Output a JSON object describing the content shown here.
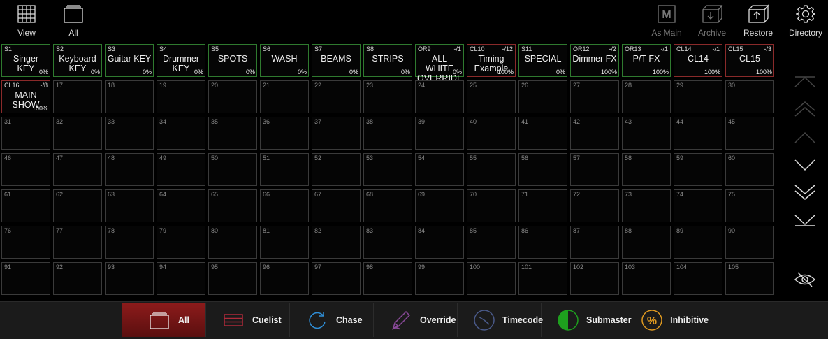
{
  "toolbar": {
    "view_label": "View",
    "all_label": "All",
    "as_main_label": "As Main",
    "archive_label": "Archive",
    "restore_label": "Restore",
    "directory_label": "Directory"
  },
  "cells": [
    {
      "num": "S1",
      "name": "Singer KEY",
      "pct": "0%",
      "color": "green"
    },
    {
      "num": "S2",
      "name": "Keyboard KEY",
      "pct": "0%",
      "color": "green"
    },
    {
      "num": "S3",
      "name": "Guitar KEY",
      "pct": "0%",
      "color": "green"
    },
    {
      "num": "S4",
      "name": "Drummer KEY",
      "pct": "0%",
      "color": "green"
    },
    {
      "num": "S5",
      "name": "SPOTS",
      "pct": "0%",
      "color": "green"
    },
    {
      "num": "S6",
      "name": "WASH",
      "pct": "0%",
      "color": "green"
    },
    {
      "num": "S7",
      "name": "BEAMS",
      "pct": "0%",
      "color": "green"
    },
    {
      "num": "S8",
      "name": "STRIPS",
      "pct": "0%",
      "color": "green"
    },
    {
      "num": "OR9",
      "steps": "-/1",
      "name": "ALL WHITE OVERRIDE",
      "pct": "0%",
      "color": "green"
    },
    {
      "num": "CL10",
      "steps": "-/12",
      "name": "Timing Example",
      "pct": "100%",
      "color": "red"
    },
    {
      "num": "S11",
      "name": "SPECIAL",
      "pct": "0%",
      "color": "green"
    },
    {
      "num": "OR12",
      "steps": "-/2",
      "name": "Dimmer FX",
      "pct": "100%",
      "color": "green"
    },
    {
      "num": "OR13",
      "steps": "-/1",
      "name": "P/T FX",
      "pct": "100%",
      "color": "green"
    },
    {
      "num": "CL14",
      "steps": "-/1",
      "name": "CL14",
      "pct": "100%",
      "color": "red"
    },
    {
      "num": "CL15",
      "steps": "-/3",
      "name": "CL15",
      "pct": "100%",
      "color": "red"
    },
    {
      "num": "CL16",
      "steps": "-/8",
      "name": "MAIN SHOW",
      "pct": "100%",
      "color": "red"
    }
  ],
  "empty_start": 17,
  "empty_end": 105,
  "bottom_tabs": [
    {
      "label": "All",
      "icon": "pages-icon",
      "active": true
    },
    {
      "label": "Cuelist",
      "icon": "cuelist-icon",
      "active": false
    },
    {
      "label": "Chase",
      "icon": "chase-icon",
      "active": false
    },
    {
      "label": "Override",
      "icon": "pen-icon",
      "active": false
    },
    {
      "label": "Timecode",
      "icon": "clock-icon",
      "active": false
    },
    {
      "label": "Submaster",
      "icon": "half-circle-icon",
      "active": false
    },
    {
      "label": "Inhibitive",
      "icon": "percent-icon",
      "active": false
    }
  ],
  "colors": {
    "green_border": "#2f7a2f",
    "red_border": "#8a2a2a",
    "active_tab": "#8c1b1b"
  }
}
